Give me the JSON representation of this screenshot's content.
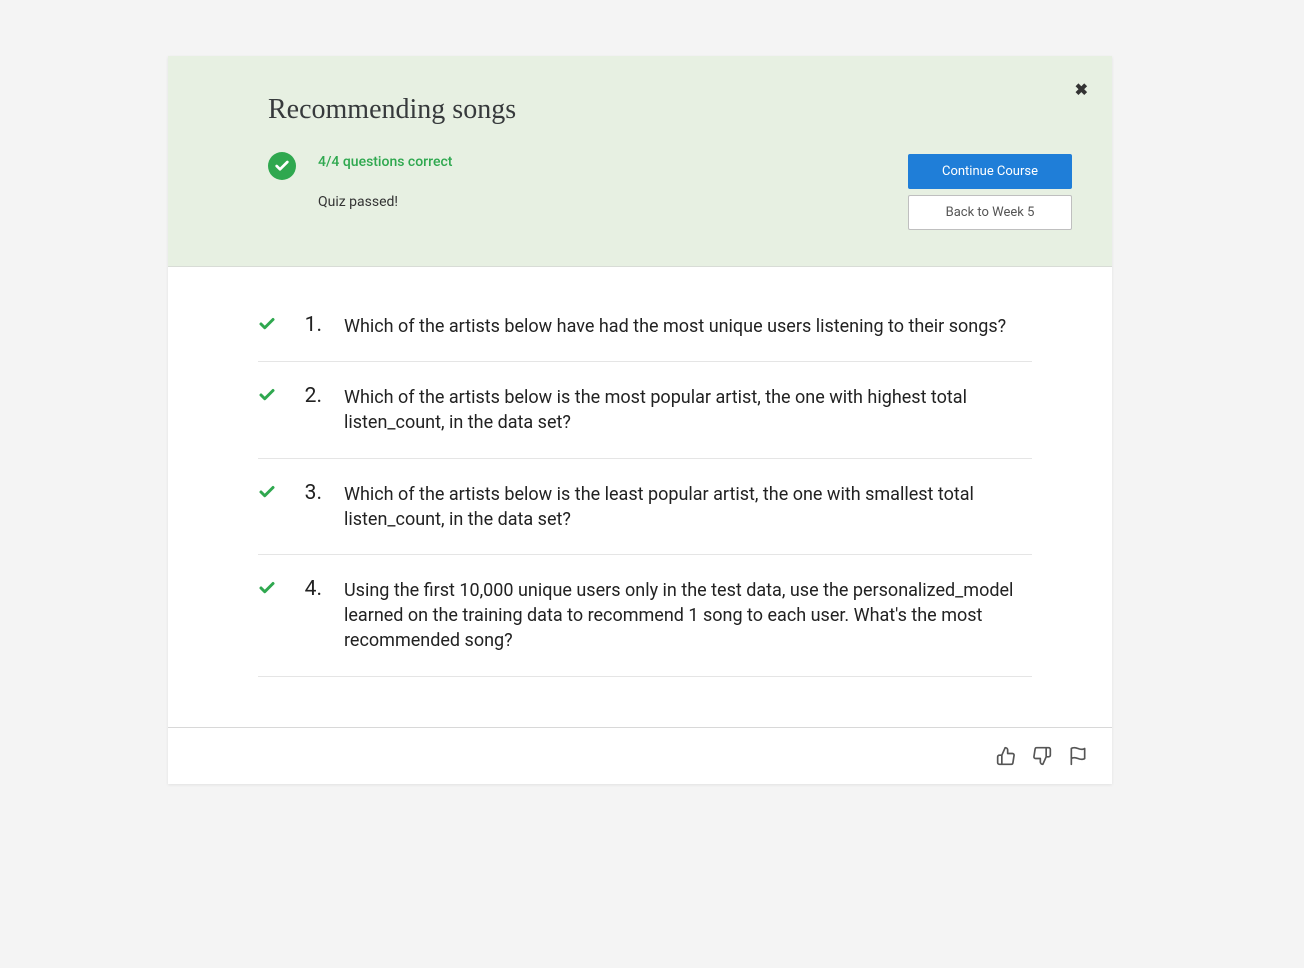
{
  "header": {
    "title": "Recommending songs",
    "score_label": "4/4 questions correct",
    "passed_label": "Quiz passed!",
    "continue_label": "Continue Course",
    "back_label": "Back to Week 5"
  },
  "questions": [
    {
      "num": "1.",
      "text": "Which of the artists below have had the most unique users listening to their songs?"
    },
    {
      "num": "2.",
      "text": "Which of the artists below is the most popular artist, the one with highest total listen_count, in the data set?"
    },
    {
      "num": "3.",
      "text": "Which of the artists below is the least popular artist, the one with smallest total listen_count, in the data set?"
    },
    {
      "num": "4.",
      "text": "Using the first 10,000 unique users only in the test data, use the personalized_model learned on the training data to recommend 1 song to each user. What's the most recommended song?"
    }
  ]
}
